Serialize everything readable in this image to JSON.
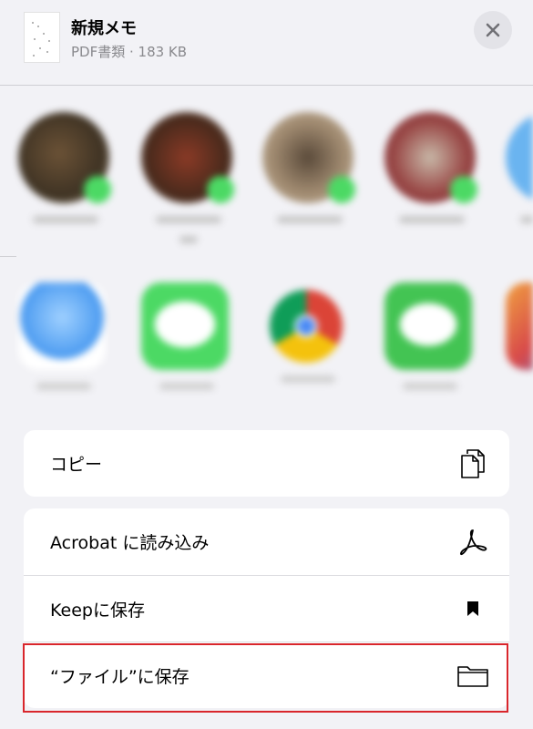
{
  "header": {
    "title": "新規メモ",
    "subtitle": "PDF書類 · 183 KB",
    "close_icon": "close-icon"
  },
  "people": [
    {
      "avatar_color": "#8a6a4a"
    },
    {
      "avatar_color": "#7a3b2a"
    },
    {
      "avatar_color": "#9a8a7a"
    },
    {
      "avatar_color": "#a04a50"
    },
    {
      "avatar_color": "#6ab4f0"
    }
  ],
  "apps": [
    {
      "icon": "airdrop-icon",
      "color": "#5aaaf5"
    },
    {
      "icon": "messages-icon",
      "color": "#4cd964"
    },
    {
      "icon": "chrome-icon",
      "color": "#e8e8e8"
    },
    {
      "icon": "line-icon",
      "color": "#43c453"
    },
    {
      "icon": "app-icon",
      "color": "#d84a4a"
    }
  ],
  "actions": {
    "copy": {
      "label": "コピー",
      "icon": "copy-icon"
    },
    "acrobat": {
      "label": "Acrobat に読み込み",
      "icon": "acrobat-icon"
    },
    "keep": {
      "label": "Keepに保存",
      "icon": "bookmark-icon"
    },
    "files": {
      "label": "“ファイル”に保存",
      "icon": "folder-icon"
    }
  },
  "colors": {
    "background": "#f2f2f6",
    "highlight": "#d9262c"
  }
}
